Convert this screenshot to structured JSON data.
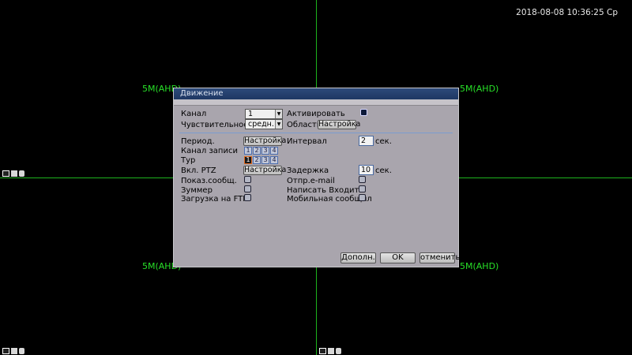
{
  "datetime": "2018-08-08 10:36:25 Ср",
  "cameras": {
    "label": "5M(AHD)"
  },
  "colors": {
    "grid": "#1db31d",
    "label": "#28e028",
    "dialog_bg": "#a9a5ad",
    "titlebar": "#1e3763"
  },
  "dialog": {
    "title": "Движение",
    "channel_label": "Канал",
    "channel_value": "1",
    "activate_label": "Активировать",
    "activate_checked": true,
    "sensitivity_label": "Чувствительность",
    "sensitivity_value": "средн.",
    "area_label": "Область",
    "area_button": "Настройка",
    "period_label": "Период.",
    "period_button": "Настройка",
    "interval_label": "Интервал",
    "interval_value": "2",
    "interval_unit": "сек.",
    "record_channel_label": "Канал записи",
    "record_channels": [
      "1",
      "2",
      "3",
      "4"
    ],
    "tour_label": "Тур",
    "tour_channels": [
      "1",
      "2",
      "3",
      "4"
    ],
    "ptz_label": "Вкл. PTZ",
    "ptz_button": "Настройка",
    "delay_label": "Задержка",
    "delay_value": "10",
    "delay_unit": "сек.",
    "show_msg_label": "Показ.сообщ.",
    "email_label": "Отпр.e-mail",
    "buzzer_label": "Зуммер",
    "write_log_label": "Написать Входить",
    "ftp_label": "Загрузка на FTP",
    "mobile_label": "Мобильная сообщил",
    "advanced_button": "Дополн.",
    "ok_button": "OK",
    "cancel_button": "отменить"
  }
}
